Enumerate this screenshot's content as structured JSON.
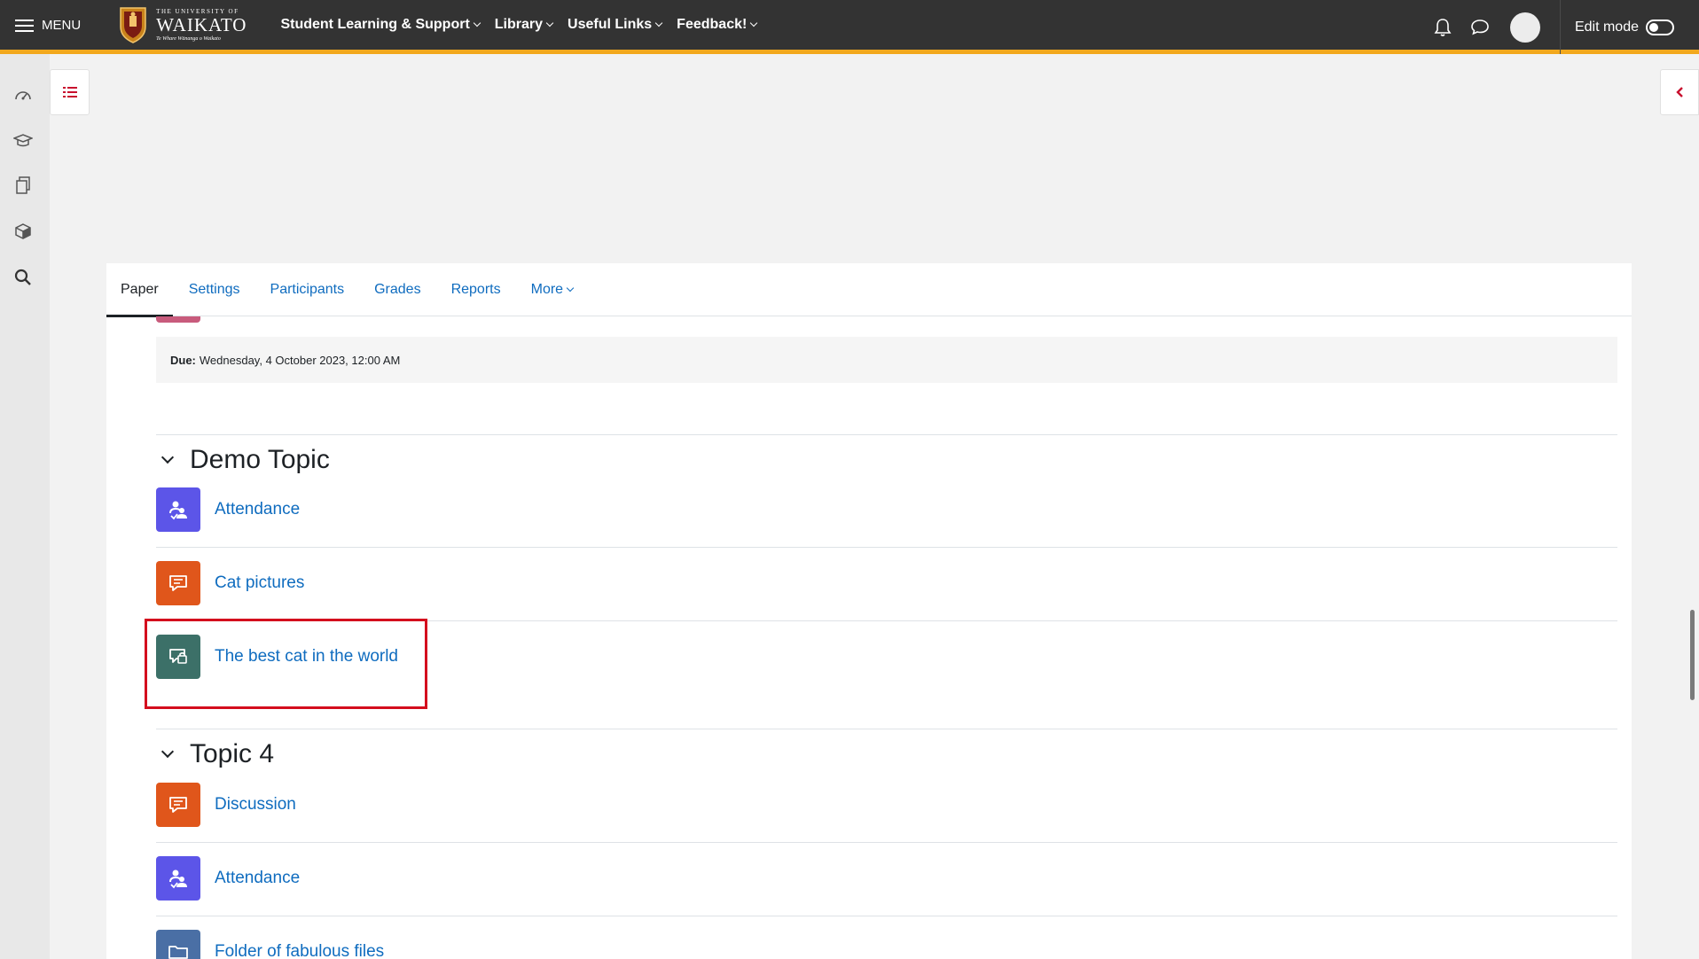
{
  "navbar": {
    "menu_label": "MENU",
    "logo_small": "THE UNIVERSITY OF",
    "logo_big": "WAIKATO",
    "logo_tagline": "Te Whare Wānanga o Waikato",
    "nav_items": [
      "Student Learning & Support",
      "Library",
      "Useful Links",
      "Feedback!"
    ],
    "edit_mode_label": "Edit mode",
    "accent_color": "#f2a81d",
    "bar_color": "#333333"
  },
  "left_rail": {
    "icons": [
      "dashboard-icon",
      "graduation-cap-icon",
      "documents-icon",
      "cube-icon",
      "search-icon"
    ]
  },
  "secondary_nav": {
    "tabs": [
      "Paper",
      "Settings",
      "Participants",
      "Grades",
      "Reports",
      "More"
    ],
    "active_tab": "Paper"
  },
  "due": {
    "label": "Due:",
    "value": "Wednesday, 4 October 2023, 12:00 AM"
  },
  "sections": [
    {
      "title": "Demo Topic",
      "activities": [
        {
          "name": "Attendance",
          "icon": "attendance-icon",
          "color": "#5c55e8"
        },
        {
          "name": "Cat pictures",
          "icon": "forum-icon",
          "color": "#e0561b"
        },
        {
          "name": "The best cat in the world",
          "icon": "chat-icon",
          "color": "#3c7068",
          "highlighted": true
        }
      ]
    },
    {
      "title": "Topic 4",
      "activities": [
        {
          "name": "Discussion",
          "icon": "forum-icon",
          "color": "#e0561b"
        },
        {
          "name": "Attendance",
          "icon": "attendance-icon",
          "color": "#5c55e8"
        },
        {
          "name": "Folder of fabulous files",
          "icon": "folder-icon",
          "color": "#4a6fa5"
        }
      ]
    }
  ],
  "highlight_color": "#d40e1e"
}
